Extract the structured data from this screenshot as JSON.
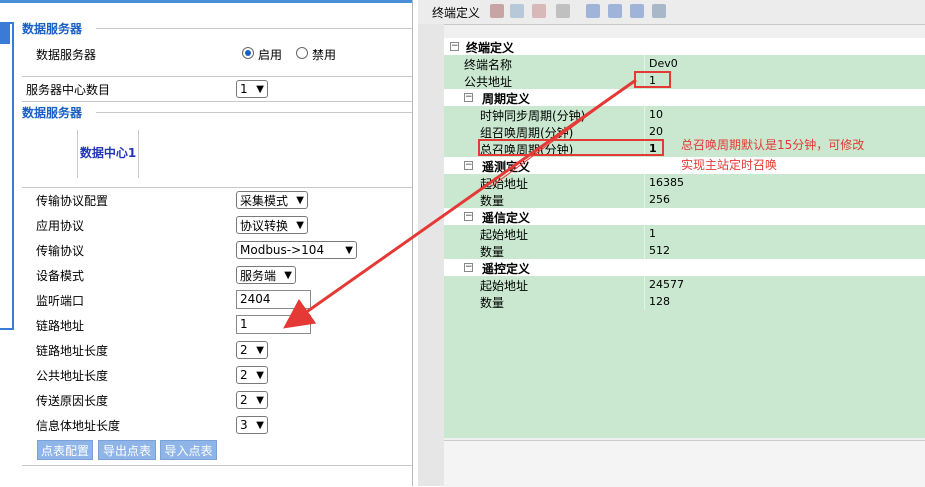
{
  "left_panel": {
    "section1_title": "数据服务器",
    "data_server_label": "数据服务器",
    "radio_enable": "启用",
    "radio_disable": "禁用",
    "server_center_count_label": "服务器中心数目",
    "server_center_count_value": "1",
    "section2_title": "数据服务器",
    "tab_label": "数据中心1",
    "fields": [
      {
        "label": "传输协议配置",
        "value": "采集模式"
      },
      {
        "label": "应用协议",
        "value": "协议转换"
      },
      {
        "label": "传输协议",
        "value": "Modbus->104"
      },
      {
        "label": "设备模式",
        "value": "服务端"
      },
      {
        "label": "监听端口",
        "value": "2404"
      },
      {
        "label": "链路地址",
        "value": "1"
      },
      {
        "label": "链路地址长度",
        "value": "2"
      },
      {
        "label": "公共地址长度",
        "value": "2"
      },
      {
        "label": "传送原因长度",
        "value": "2"
      },
      {
        "label": "信息体地址长度",
        "value": "3"
      }
    ],
    "buttons": [
      "点表配置",
      "导出点表",
      "导入点表"
    ]
  },
  "right_panel": {
    "title": "终端定义",
    "rows": [
      {
        "label": "终端定义",
        "value": "",
        "level": 0,
        "header": true
      },
      {
        "label": "终端名称",
        "value": "Dev0",
        "level": 1
      },
      {
        "label": "公共地址",
        "value": "1",
        "level": 1
      },
      {
        "label": "周期定义",
        "value": "",
        "level": 1,
        "header": true
      },
      {
        "label": "时钟同步周期(分钟)",
        "value": "10",
        "level": 2
      },
      {
        "label": "组召唤周期(分钟)",
        "value": "20",
        "level": 2
      },
      {
        "label": "总召唤周期(分钟)",
        "value": "1",
        "level": 2
      },
      {
        "label": "遥测定义",
        "value": "",
        "level": 1,
        "header": true
      },
      {
        "label": "起始地址",
        "value": "16385",
        "level": 2
      },
      {
        "label": "数量",
        "value": "256",
        "level": 2
      },
      {
        "label": "遥信定义",
        "value": "",
        "level": 1,
        "header": true
      },
      {
        "label": "起始地址",
        "value": "1",
        "level": 2
      },
      {
        "label": "数量",
        "value": "512",
        "level": 2
      },
      {
        "label": "遥控定义",
        "value": "",
        "level": 1,
        "header": true
      },
      {
        "label": "起始地址",
        "value": "24577",
        "level": 2
      },
      {
        "label": "数量",
        "value": "128",
        "level": 2
      }
    ]
  },
  "annotation": {
    "line1": "总召唤周期默认是15分钟，可修改",
    "line2": "实现主站定时召唤"
  },
  "colors": {
    "accent": "#1a5fc4",
    "grid_bg": "#c9e8cf",
    "annotation": "#e53935"
  }
}
